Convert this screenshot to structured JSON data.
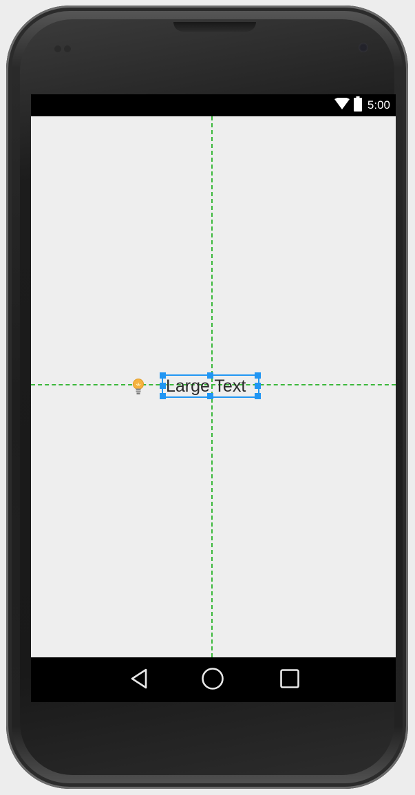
{
  "status_bar": {
    "time": "5:00",
    "icons": [
      "wifi-icon",
      "battery-icon"
    ]
  },
  "layout_editor": {
    "text_view_label": "Large Text",
    "guide_color": "#3ab83a",
    "selection_color": "#2196f3",
    "hint_icon": "lightbulb-icon"
  },
  "nav_bar": {
    "buttons": [
      "back-icon",
      "home-icon",
      "recents-icon"
    ]
  },
  "colors": {
    "screen_background": "#eeeeee",
    "bars": "#000000"
  }
}
